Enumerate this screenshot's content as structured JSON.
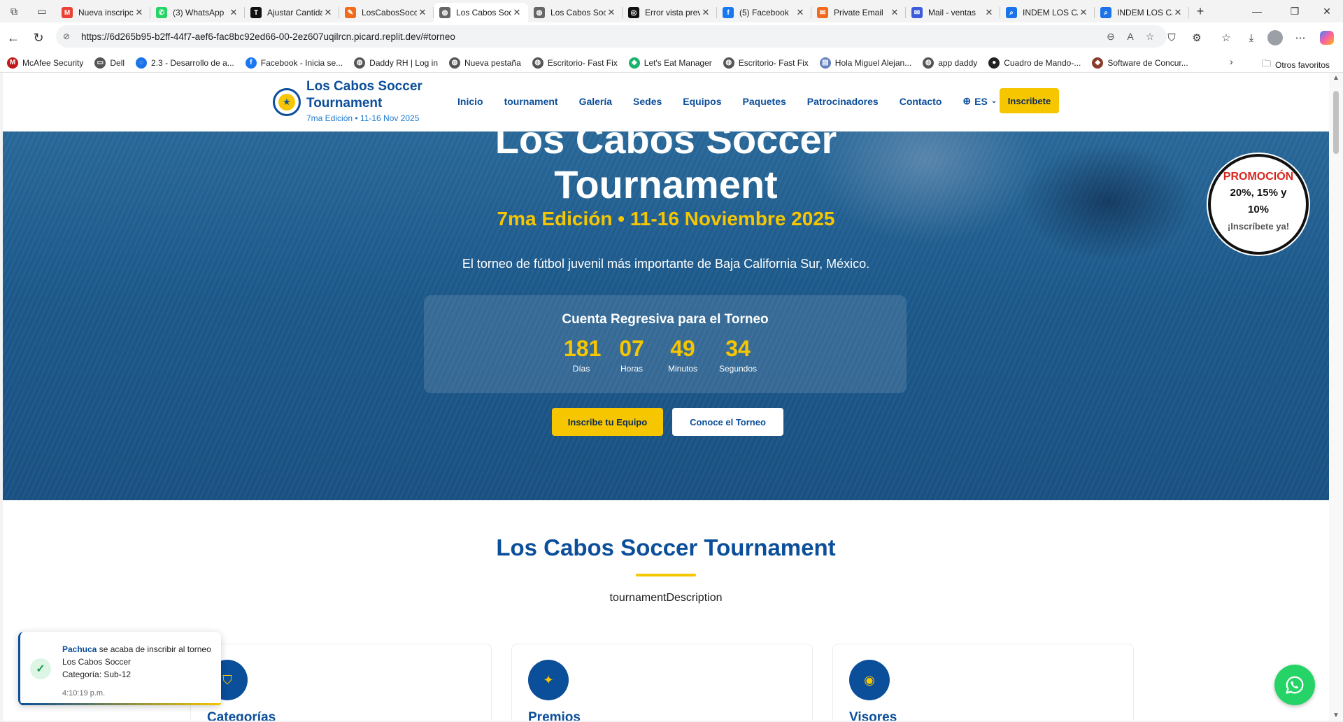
{
  "browser": {
    "tabs": [
      {
        "title": "Nueva inscripción",
        "fav": "M",
        "color": "#ea4335"
      },
      {
        "title": "(3) WhatsApp",
        "fav": "✆",
        "color": "#25d366"
      },
      {
        "title": "Ajustar Cantidad",
        "fav": "T",
        "color": "#111111"
      },
      {
        "title": "LosCabosSoccer",
        "fav": "✎",
        "color": "#f26a1b"
      },
      {
        "title": "Los Cabos Soccer",
        "fav": "◍",
        "color": "#666666",
        "active": true
      },
      {
        "title": "Los Cabos Soccer",
        "fav": "◍",
        "color": "#666666"
      },
      {
        "title": "Error vista previa",
        "fav": "◎",
        "color": "#111111"
      },
      {
        "title": "(5) Facebook",
        "fav": "f",
        "color": "#1877f2"
      },
      {
        "title": "Private Email",
        "fav": "✉",
        "color": "#f26a1b"
      },
      {
        "title": "Mail - ventas",
        "fav": "✉",
        "color": "#3b5bdb"
      },
      {
        "title": "INDEM LOS CABOS",
        "fav": "⌕",
        "color": "#1a73e8"
      },
      {
        "title": "INDEM LOS CABOS",
        "fav": "⌕",
        "color": "#1a73e8"
      }
    ],
    "url": "https://6d265b95-b2ff-44f7-aef6-fac8bc92ed66-00-2ez607uqilrcn.picard.replit.dev/#torneo",
    "bookmarks": [
      {
        "label": "McAfee Security",
        "icon": "M",
        "color": "#c01818"
      },
      {
        "label": "Dell",
        "icon": "▭",
        "color": "#555555"
      },
      {
        "label": "2.3 - Desarrollo de a...",
        "icon": "◌",
        "color": "#1a73e8"
      },
      {
        "label": "Facebook - Inicia se...",
        "icon": "f",
        "color": "#1877f2"
      },
      {
        "label": "Daddy RH | Log in",
        "icon": "◍",
        "color": "#555555"
      },
      {
        "label": "Nueva pestaña",
        "icon": "◍",
        "color": "#555555"
      },
      {
        "label": "Escritorio- Fast Fix",
        "icon": "◍",
        "color": "#555555"
      },
      {
        "label": "Let's Eat Manager",
        "icon": "◆",
        "color": "#19b36b"
      },
      {
        "label": "Escritorio- Fast Fix",
        "icon": "◍",
        "color": "#555555"
      },
      {
        "label": "Hola Miguel Alejan...",
        "icon": "▤",
        "color": "#5f7fbf"
      },
      {
        "label": "app daddy",
        "icon": "◍",
        "color": "#555555"
      },
      {
        "label": "Cuadro de Mando-...",
        "icon": "●",
        "color": "#222222"
      },
      {
        "label": "Software de Concur...",
        "icon": "◆",
        "color": "#8a3b2a"
      }
    ],
    "other_favorites": "Otros favoritos"
  },
  "site": {
    "brand_title": "Los Cabos Soccer Tournament",
    "brand_sub": "7ma Edición • 11-16 Nov 2025",
    "nav": [
      "Inicio",
      "tournament",
      "Galería",
      "Sedes",
      "Equipos",
      "Paquetes",
      "Patrocinadores",
      "Contacto"
    ],
    "lang": "ES",
    "cta": "Inscribete"
  },
  "hero": {
    "title": "Los Cabos Soccer Tournament",
    "edition": "7ma Edición • 11-16 Noviembre 2025",
    "subtitle": "El torneo de fútbol juvenil más importante de Baja California Sur, México.",
    "countdown_title": "Cuenta Regresiva para el Torneo",
    "countdown": [
      {
        "value": "181",
        "label": "Días"
      },
      {
        "value": "07",
        "label": "Horas"
      },
      {
        "value": "49",
        "label": "Minutos"
      },
      {
        "value": "34",
        "label": "Segundos"
      }
    ],
    "btn_primary": "Inscribe tu Equipo",
    "btn_secondary": "Conoce el Torneo"
  },
  "promo": {
    "line1": "PROMOCIÓN",
    "line2": "20%, 15% y 10%",
    "line3": "¡Inscríbete ya!"
  },
  "section": {
    "title": "Los Cabos Soccer Tournament",
    "description": "tournamentDescription",
    "cards": [
      {
        "title": "Categorías",
        "icon": "shield-icon"
      },
      {
        "title": "Premios",
        "icon": "sparkle-icon"
      },
      {
        "title": "Visores",
        "icon": "eye-icon"
      }
    ]
  },
  "toast": {
    "team": "Pachuca",
    "message": " se acaba de inscribir al torneo Los Cabos Soccer",
    "category": "Categoría: Sub-12",
    "time": "4:10:19 p.m."
  }
}
